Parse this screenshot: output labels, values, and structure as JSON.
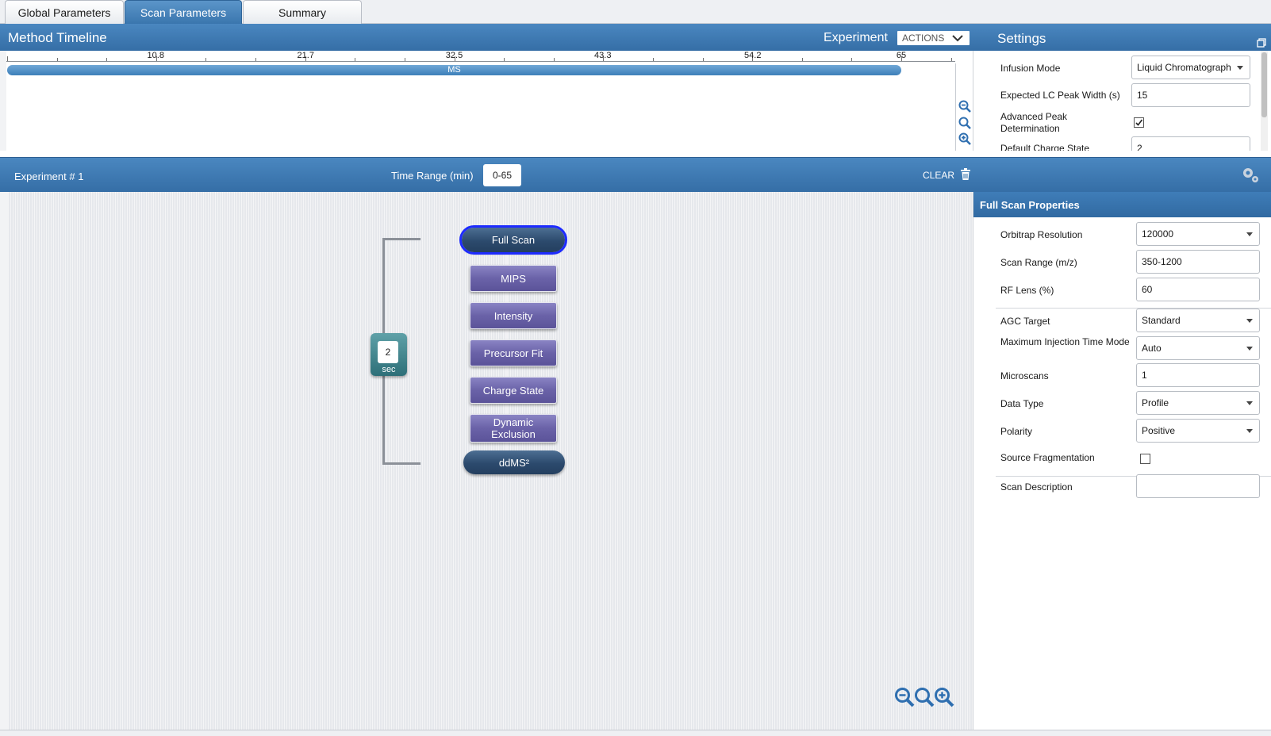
{
  "tabs": [
    "Global Parameters",
    "Scan Parameters",
    "Summary"
  ],
  "timeline": {
    "title": "Method Timeline",
    "experiment_label": "Experiment",
    "actions_label": "ACTIONS",
    "ticks": [
      "10.8",
      "21.7",
      "32.5",
      "43.3",
      "54.2",
      "65"
    ],
    "bar_label": "MS"
  },
  "settings": {
    "title": "Settings",
    "infusion_mode_label": "Infusion Mode",
    "infusion_mode_value": "Liquid Chromatograph",
    "peak_width_label": "Expected LC Peak Width (s)",
    "peak_width_value": "15",
    "advanced_peak_label": "Advanced Peak Determination",
    "advanced_peak_checked": true,
    "charge_state_label": "Default Charge State",
    "charge_state_value": "2"
  },
  "experiment": {
    "title": "Experiment # 1",
    "time_range_label": "Time Range (min)",
    "time_range_value": "0-65",
    "clear_label": "CLEAR"
  },
  "workflow": {
    "full_scan": "Full Scan",
    "filters": [
      "MIPS",
      "Intensity",
      "Precursor Fit",
      "Charge State",
      "Dynamic Exclusion"
    ],
    "ddms2": "ddMS²",
    "cycle_value": "2",
    "cycle_unit": "sec"
  },
  "properties": {
    "title": "Full Scan Properties",
    "orbitrap_resolution_label": "Orbitrap Resolution",
    "orbitrap_resolution_value": "120000",
    "scan_range_label": "Scan Range (m/z)",
    "scan_range_value": "350-1200",
    "rf_lens_label": "RF Lens (%)",
    "rf_lens_value": "60",
    "agc_target_label": "AGC Target",
    "agc_target_value": "Standard",
    "max_injection_label": "Maximum Injection Time Mode",
    "max_injection_value": "Auto",
    "microscans_label": "Microscans",
    "microscans_value": "1",
    "data_type_label": "Data Type",
    "data_type_value": "Profile",
    "polarity_label": "Polarity",
    "polarity_value": "Positive",
    "source_frag_label": "Source Fragmentation",
    "source_frag_checked": false,
    "scan_description_label": "Scan Description",
    "scan_description_value": ""
  },
  "colors": {
    "header_blue": "#3f7cb6",
    "filter_purple": "#6a62a8",
    "scan_node": "#2c4a6d",
    "selected_outline": "#1d2bff",
    "cycle_teal": "#3f848c"
  }
}
